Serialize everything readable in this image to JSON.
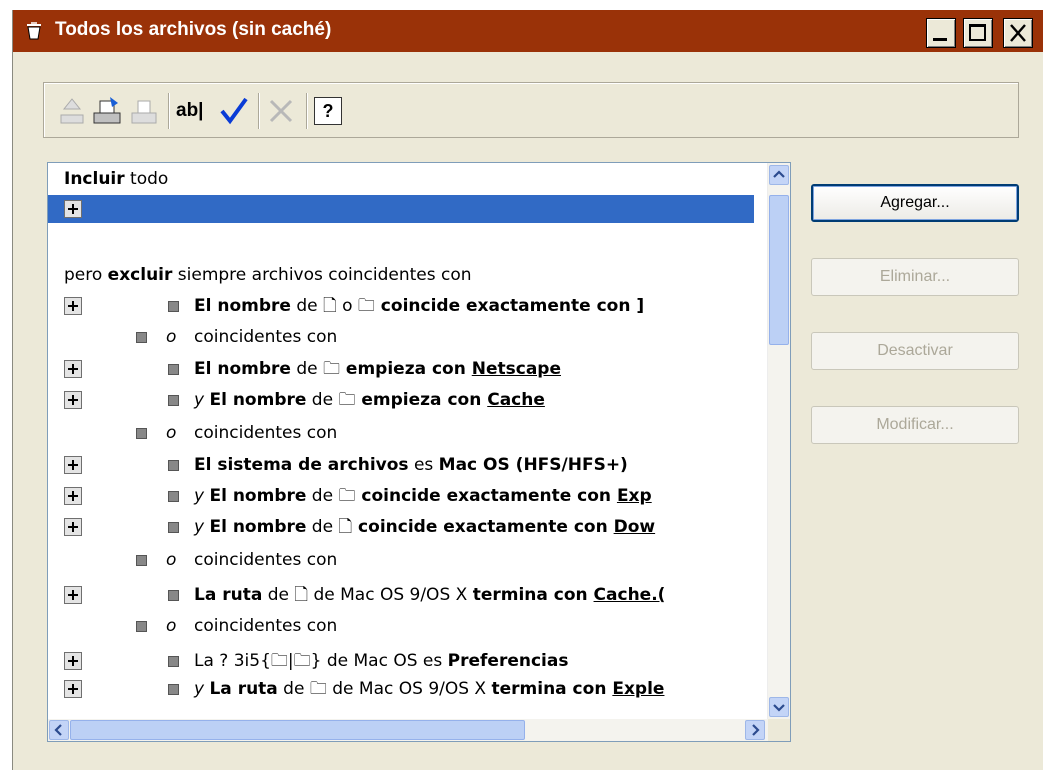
{
  "window": {
    "title": "Todos los archivos (sin caché)"
  },
  "toolbar": {
    "rename_label": "ab|",
    "help_label": "?"
  },
  "list": {
    "header_strong": "Incluir",
    "header_rest": " todo",
    "exclude_pre": "pero ",
    "exclude_strong": "excluir",
    "exclude_post": " siempre archivos coincidentes con",
    "rows": [
      {
        "a": "El nombre",
        "b": " de ",
        "c": " o ",
        "d": " coincide exactamente con ]",
        "e": ""
      },
      {
        "a": "o",
        "b": "coincidentes con"
      },
      {
        "a": "El nombre",
        "b": " de ",
        "c": " empieza con ",
        "d": "Netscape"
      },
      {
        "a": "y ",
        "b": "El nombre",
        "c": " de ",
        "d": " empieza con ",
        "e": "Cache"
      },
      {
        "a": "o",
        "b": "coincidentes con"
      },
      {
        "a": "El sistema de archivos",
        "b": " es ",
        "c": "Mac OS (HFS/HFS+)"
      },
      {
        "a": "y ",
        "b": "El nombre",
        "c": " de ",
        "d": " coincide exactamente con ",
        "e": "Exp"
      },
      {
        "a": "y ",
        "b": "El nombre",
        "c": " de ",
        "d": " coincide exactamente con ",
        "e": "Dow"
      },
      {
        "a": "o",
        "b": "coincidentes con"
      },
      {
        "a": "La ruta",
        "b": " de ",
        "c": " de Mac OS 9/OS X ",
        "d": "termina con ",
        "e": "Cache.("
      },
      {
        "a": "o",
        "b": "coincidentes con"
      },
      {
        "a": "La ? 3i5{",
        "b": "|",
        "c": "} de Mac OS es ",
        "d": "Preferencias"
      },
      {
        "a": "y ",
        "b": "La ruta",
        "c": " de ",
        "d": " de Mac OS 9/OS X ",
        "e": "termina con ",
        "f": "Exple"
      }
    ]
  },
  "buttons": {
    "add": "Agregar...",
    "remove": "Eliminar...",
    "deactivate": "Desactivar",
    "modify": "Modificar..."
  },
  "colors": {
    "titlebar": "#9a3208",
    "selection": "#316ac5",
    "check": "#0a3cd6"
  }
}
